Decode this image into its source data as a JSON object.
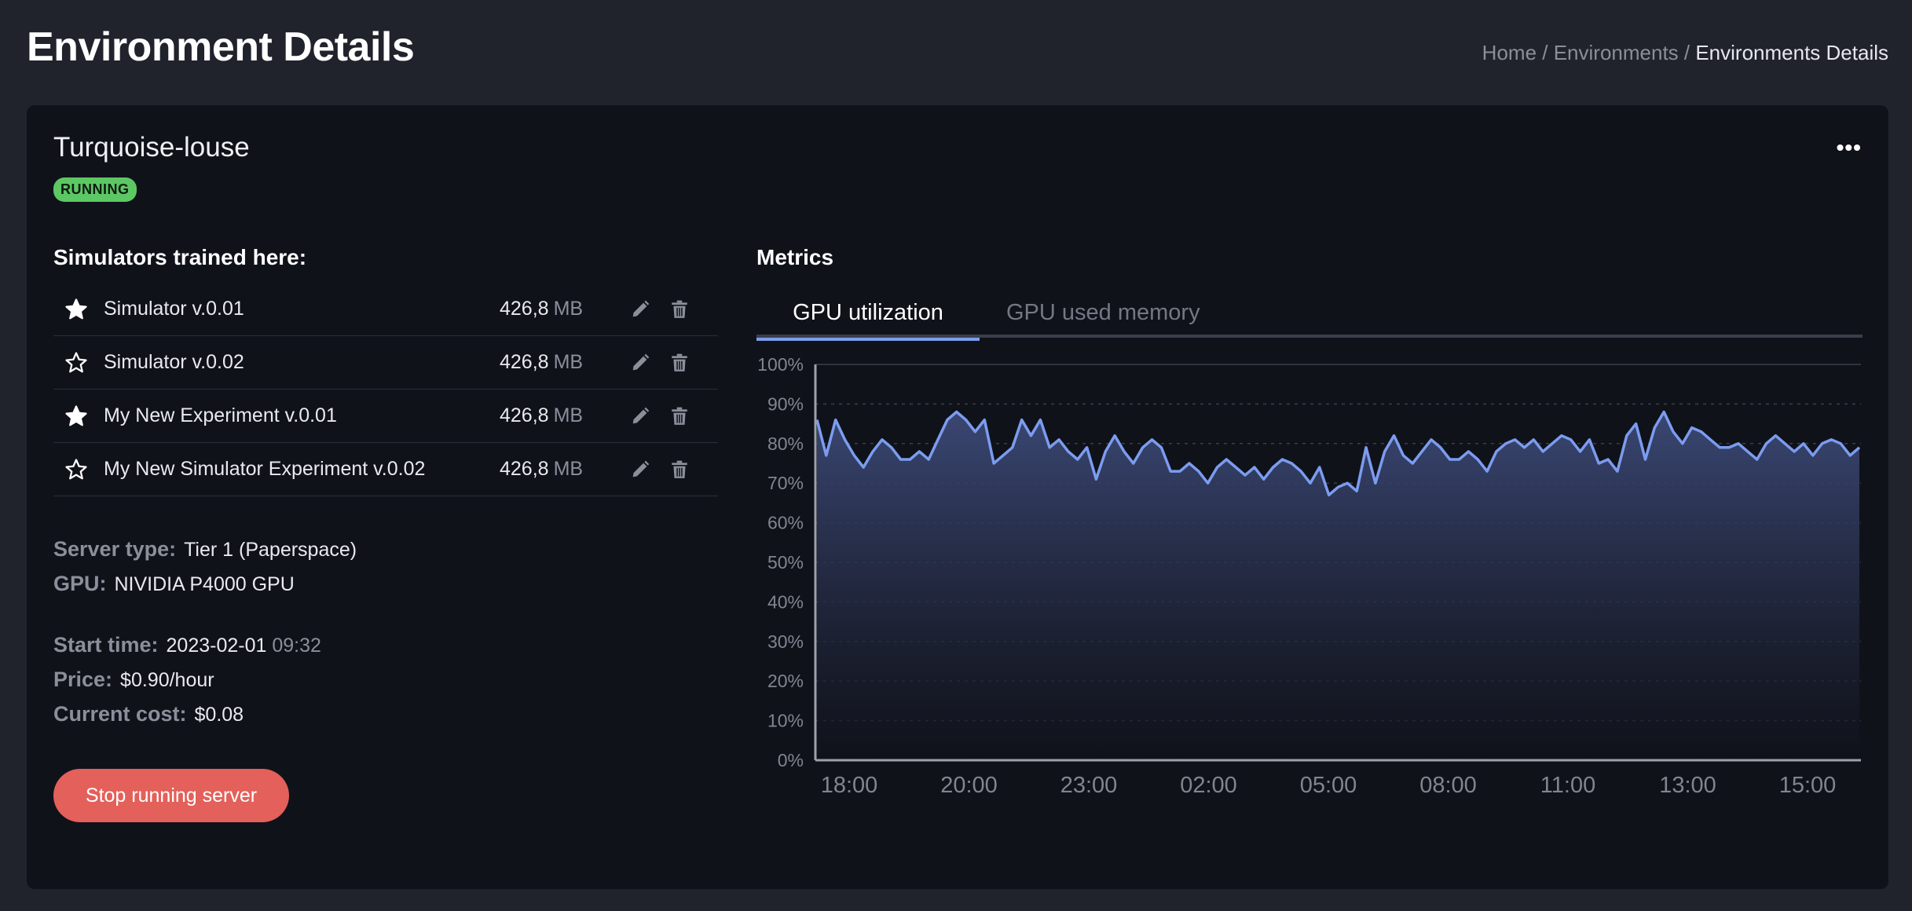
{
  "page": {
    "title": "Environment Details"
  },
  "breadcrumb": {
    "home": "Home",
    "sep1": " / ",
    "environments": "Environments",
    "sep2": " / ",
    "current": "Environments Details"
  },
  "environment": {
    "name": "Turquoise-louse",
    "status": "RUNNING",
    "more_label": "•••"
  },
  "simulators": {
    "heading": "Simulators trained here:",
    "items": [
      {
        "name": "Simulator v.0.01",
        "size": "426,8",
        "unit": "MB",
        "starred": true
      },
      {
        "name": "Simulator v.0.02",
        "size": "426,8",
        "unit": "MB",
        "starred": false
      },
      {
        "name": "My New Experiment v.0.01",
        "size": "426,8",
        "unit": "MB",
        "starred": true
      },
      {
        "name": "My New Simulator Experiment v.0.02",
        "size": "426,8",
        "unit": "MB",
        "starred": false
      }
    ]
  },
  "server": {
    "type_label": "Server type:",
    "type_value": "Tier 1 (Paperspace)",
    "gpu_label": "GPU:",
    "gpu_value": "NIVIDIA P4000 GPU",
    "start_label": "Start time:",
    "start_date": "2023-02-01",
    "start_time": "09:32",
    "price_label": "Price:",
    "price_value": "$0.90/hour",
    "cost_label": "Current cost:",
    "cost_value": "$0.08"
  },
  "actions": {
    "stop_label": "Stop running server"
  },
  "metrics": {
    "heading": "Metrics",
    "tabs": [
      {
        "label": "GPU utilization",
        "active": true
      },
      {
        "label": "GPU used memory",
        "active": false
      }
    ]
  },
  "colors": {
    "accent": "#7b9cf0",
    "running": "#5cc864",
    "danger": "#e4605a",
    "card_bg": "#10121a",
    "page_bg": "#20232c"
  },
  "chart_data": {
    "type": "area",
    "title": "",
    "xlabel": "",
    "ylabel": "",
    "ylim": [
      0,
      100
    ],
    "y_ticks": [
      "0%",
      "10%",
      "20%",
      "30%",
      "40%",
      "50%",
      "60%",
      "70%",
      "80%",
      "90%",
      "100%"
    ],
    "x_ticks": [
      "18:00",
      "20:00",
      "23:00",
      "02:00",
      "05:00",
      "08:00",
      "11:00",
      "13:00",
      "15:00"
    ],
    "grid": true,
    "series": [
      {
        "values": [
          86,
          77,
          86,
          81,
          77,
          74,
          78,
          81,
          79,
          76,
          76,
          78,
          76,
          81,
          86,
          88,
          86,
          83,
          86,
          75,
          77,
          79,
          86,
          82,
          86,
          79,
          81,
          78,
          76,
          79,
          71,
          78,
          82,
          78,
          75,
          79,
          81,
          79,
          73,
          73,
          75,
          73,
          70,
          74,
          76,
          74,
          72,
          74,
          71,
          74,
          76,
          75,
          73,
          70,
          74,
          67,
          69,
          70,
          68,
          79,
          70,
          78,
          82,
          77,
          75,
          78,
          81,
          79,
          76,
          76,
          78,
          76,
          73,
          78,
          80,
          81,
          79,
          81,
          78,
          80,
          82,
          81,
          78,
          81,
          75,
          76,
          73,
          82,
          85,
          76,
          84,
          88,
          83,
          80,
          84,
          83,
          81,
          79,
          79,
          80,
          78,
          76,
          80,
          82,
          80,
          78,
          80,
          77,
          80,
          81,
          80,
          77,
          79
        ]
      }
    ]
  }
}
